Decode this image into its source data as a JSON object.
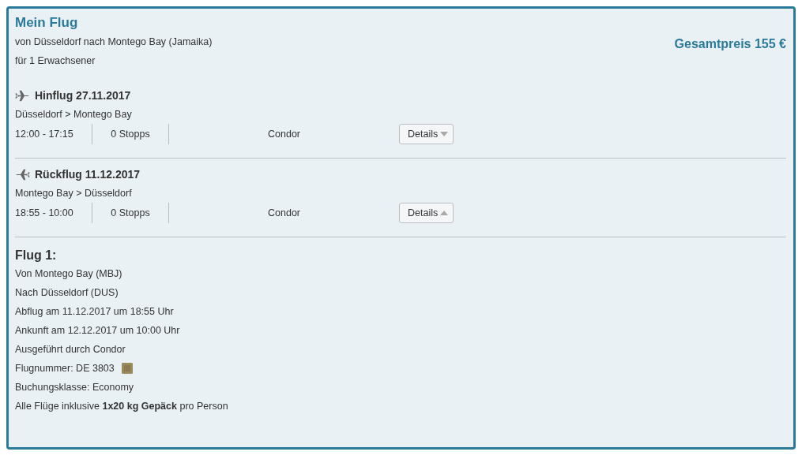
{
  "header": {
    "title": "Mein Flug",
    "route": "von Düsseldorf nach Montego Bay (Jamaika)",
    "passengers": "für 1 Erwachsener",
    "total_price": "Gesamtpreis 155 €"
  },
  "legs": [
    {
      "kind": "outbound",
      "title": "Hinflug 27.11.2017",
      "route": "Düsseldorf > Montego Bay",
      "times": "12:00 - 17:15",
      "stops": "0 Stopps",
      "airline": "Condor",
      "details_button": "Details",
      "expanded": false
    },
    {
      "kind": "return",
      "title": "Rückflug 11.12.2017",
      "route": "Montego Bay > Düsseldorf",
      "times": "18:55 - 10:00",
      "stops": "0 Stopps",
      "airline": "Condor",
      "details_button": "Details",
      "expanded": true,
      "details": {
        "title": "Flug 1:",
        "lines": [
          {
            "text": "Von Montego Bay (MBJ)",
            "logo": false
          },
          {
            "text": "Nach Düsseldorf (DUS)",
            "logo": false
          },
          {
            "text": "Abflug am 11.12.2017 um 18:55 Uhr",
            "logo": false
          },
          {
            "text": "Ankunft am 12.12.2017 um 10:00 Uhr",
            "logo": false
          },
          {
            "text": "Ausgeführt durch Condor",
            "logo": false
          },
          {
            "text": "Flugnummer: DE 3803",
            "logo": true
          },
          {
            "text": "Buchungsklasse: Economy",
            "logo": false
          },
          {
            "text": "Alle Flüge inklusive **1x20 kg Gepäck** pro Person",
            "logo": false
          }
        ]
      }
    }
  ]
}
